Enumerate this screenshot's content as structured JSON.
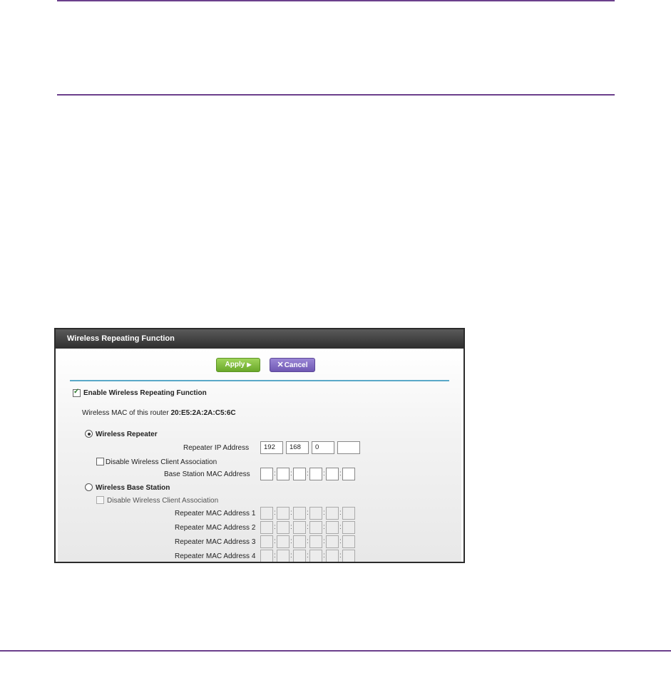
{
  "panel": {
    "title": "Wireless Repeating Function",
    "apply_label": "Apply",
    "cancel_label": "Cancel",
    "enable_label": "Enable Wireless Repeating Function",
    "mac_prefix": "Wireless MAC of this router",
    "mac_value": "20:E5:2A:2A:C5:6C",
    "repeater": {
      "label": "Wireless Repeater",
      "ip_label": "Repeater IP Address",
      "ip": [
        "192",
        "168",
        "0",
        ""
      ],
      "disable_assoc_label": "Disable Wireless Client Association",
      "base_mac_label": "Base Station MAC Address"
    },
    "base_station": {
      "label": "Wireless Base Station",
      "disable_assoc_label": "Disable Wireless Client Association",
      "mac_labels": [
        "Repeater MAC Address 1",
        "Repeater MAC Address 2",
        "Repeater MAC Address 3",
        "Repeater MAC Address 4"
      ]
    }
  },
  "colors": {
    "rule": "#6b3f8c",
    "apply": "#7bbf3a",
    "cancel": "#7a62c2",
    "accent_line": "#5aa8c8"
  }
}
